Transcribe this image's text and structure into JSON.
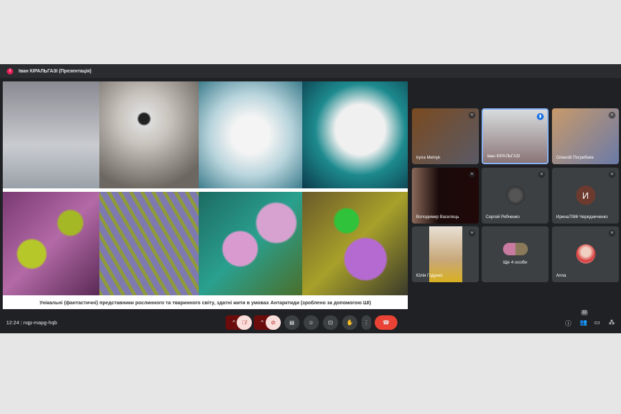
{
  "header": {
    "presenter_label": "Іван КІРАЛЬГАЗІ (Презентація)",
    "badge_icon": "presentation-dot-icon"
  },
  "presentation": {
    "caption": "Унікальні (фантастичні) представники рослинного та тваринного світу, здатні жити в умовах Антарктиди (зроблено за допомогою ШІ)"
  },
  "participants": [
    {
      "name": "Iryna Melnyk",
      "muted": true
    },
    {
      "name": "Іван КІРАЛЬГАЗІ",
      "speaking": true
    },
    {
      "name": "Олексій Погребняк",
      "muted": true
    },
    {
      "name": "Володимир Василець",
      "muted": true
    },
    {
      "name": "Сергей Рябченко",
      "muted": true
    },
    {
      "name": "Ирина7086 Чередниченко",
      "initial": "И",
      "muted": true
    },
    {
      "name": "Юлія Годунко",
      "muted": true
    },
    {
      "name": "Ще 4 особи"
    },
    {
      "name": "Anna",
      "muted": true
    }
  ],
  "bottom": {
    "time": "12:24",
    "separator": "|",
    "meeting_code": "nqp-mapg-hqb",
    "people_count": "13"
  },
  "colors": {
    "accent": "#8ab4f8",
    "end_call": "#ea4335",
    "muted_bg": "#f9dedc",
    "dark_red": "#6b0c0c"
  }
}
